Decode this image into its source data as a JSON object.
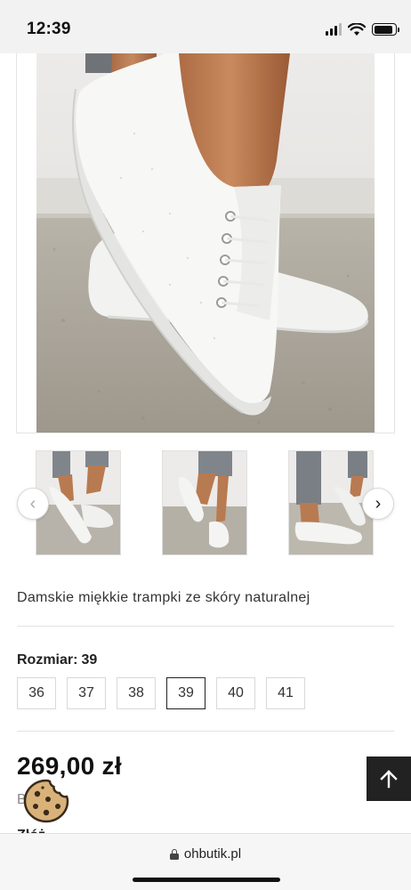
{
  "status_bar": {
    "time": "12:39",
    "icons": [
      "cellular-signal-icon",
      "wifi-icon",
      "battery-icon"
    ],
    "battery_level": 0.9
  },
  "gallery": {
    "main_image": "white-leather-sneaker-photo",
    "thumbnails": [
      "sneaker-thumbnail-1",
      "sneaker-thumbnail-2",
      "sneaker-thumbnail-3"
    ],
    "prev_icon": "chevron-left-icon",
    "next_icon": "chevron-right-icon",
    "prev": "‹",
    "next": "›"
  },
  "product": {
    "title": "Damskie miękkie trampki ze skóry naturalnej",
    "size_label": "Rozmiar:",
    "selected_size": "39",
    "sizes": [
      "36",
      "37",
      "38",
      "39",
      "40",
      "41"
    ],
    "price": "269,00 zł",
    "price_sub": "B"
  },
  "browser": {
    "url": "ohbutik.pl"
  },
  "colors": {
    "accent": "#222222",
    "scroll_top_bg": "#222222",
    "floor": "#a9a49b",
    "wall": "#e9e8e6"
  }
}
